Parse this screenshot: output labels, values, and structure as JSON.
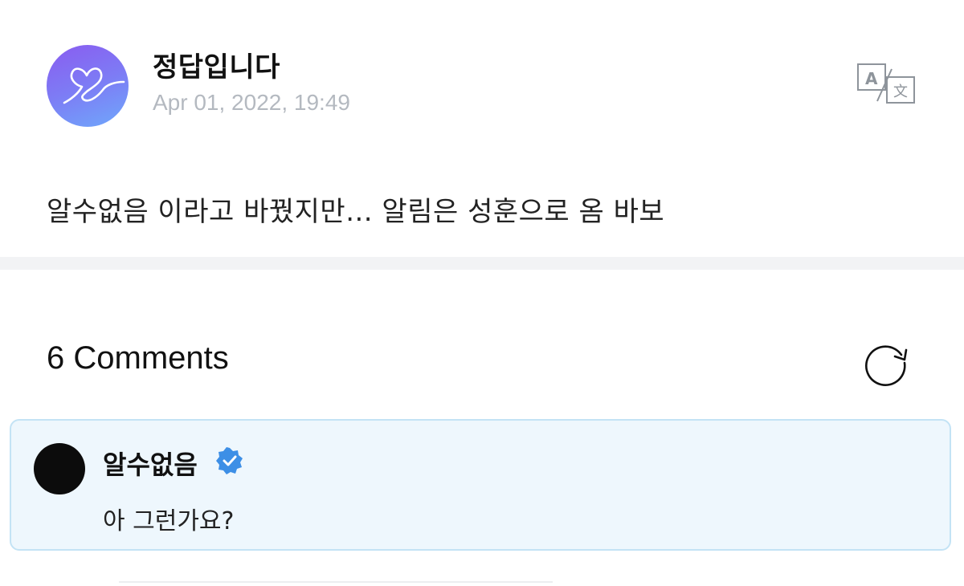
{
  "post": {
    "author": "정답입니다",
    "date": "Apr 01, 2022, 19:49",
    "body": "알수없음 이라고 바꿨지만... 알림은 성훈으로 옴 바보",
    "avatar_icon": "heart-scribble-icon",
    "translate_icon": "translate-icon"
  },
  "comments": {
    "title": "6 Comments",
    "refresh_icon": "refresh-icon",
    "items": [
      {
        "author": "알수없음",
        "verified": true,
        "text": "아 그런가요?"
      }
    ]
  },
  "colors": {
    "avatar_gradient_start": "#8a5cf0",
    "avatar_gradient_end": "#6fa8fb",
    "date_gray": "#b4b9c0",
    "highlight_bg": "#eef7fd",
    "highlight_border": "#c3e3f5",
    "verified_blue": "#3d8fe6",
    "divider": "#f2f3f5"
  }
}
